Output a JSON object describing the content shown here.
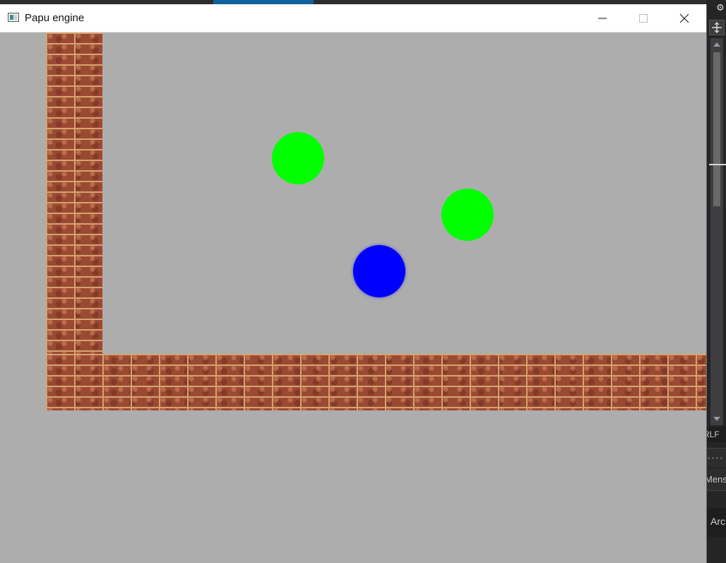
{
  "window": {
    "title": "Papu engine",
    "controls": {
      "minimize": "minimize",
      "maximize": "maximize",
      "close": "close"
    }
  },
  "game": {
    "background_color": "#adadad",
    "wall_texture": "brick",
    "walls": [
      "left-wall",
      "floor-wall"
    ],
    "entities": [
      {
        "type": "enemy",
        "shape": "circle",
        "color": "#00ff00"
      },
      {
        "type": "enemy",
        "shape": "circle",
        "color": "#00ff00"
      },
      {
        "type": "player",
        "shape": "circle",
        "color": "#0000ff"
      }
    ]
  },
  "background_app": {
    "status_line_ending": "RLF",
    "label_1": "Mens",
    "label_2": "Arc"
  }
}
